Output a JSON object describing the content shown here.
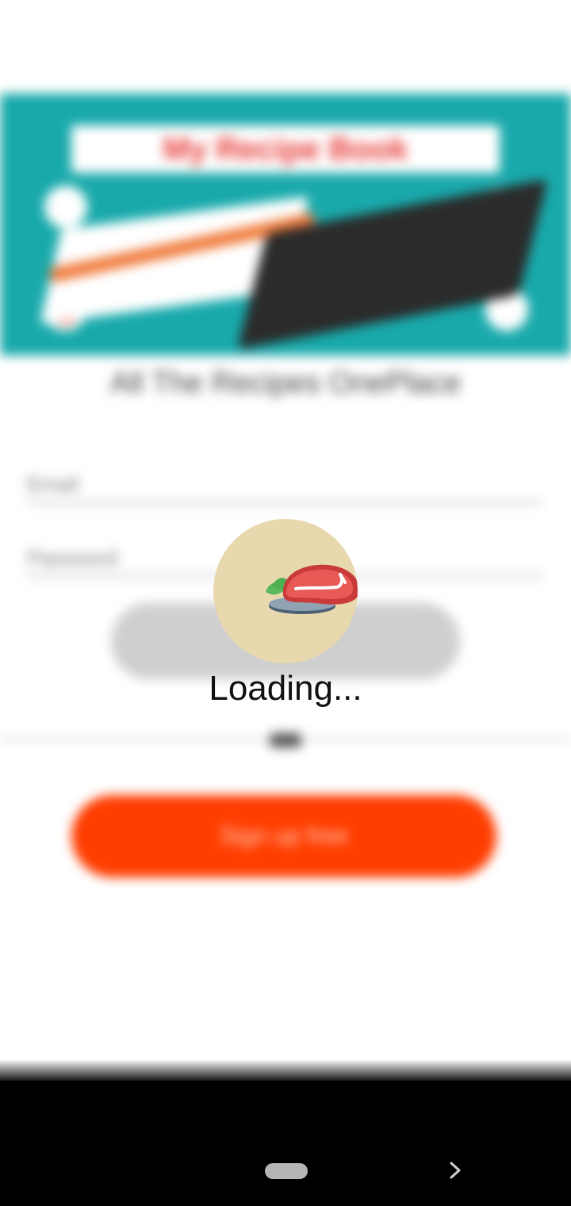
{
  "background": {
    "banner_title": "My Recipe Book",
    "headline": "All The Recipes OnePlace",
    "email_label": "Email",
    "password_label": "Password",
    "signup_label": "Sign up free",
    "colors": {
      "banner": "#19a9ab",
      "signup_button": "#ff3d00",
      "login_button": "#cfcfcf"
    }
  },
  "loader": {
    "icon": "steak-icon",
    "text": "Loading...",
    "circle_color": "#e8d8ae"
  },
  "navbar": {
    "home_icon": "home-pill",
    "forward_icon": "chevron-right-icon"
  }
}
